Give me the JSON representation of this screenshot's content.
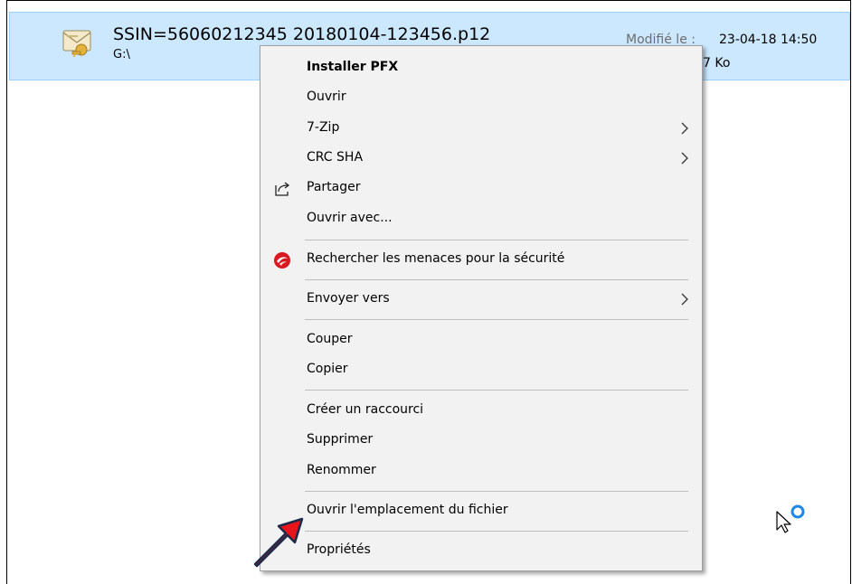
{
  "file": {
    "name": "SSIN=56060212345 20180104-123456.p12",
    "path": "G:\\",
    "modified_label": "Modifié le :",
    "modified_value": "23-04-18 14:50",
    "size_value": "7 Ko",
    "icon": "certificate-file-icon"
  },
  "context_menu": {
    "items": [
      {
        "label": "Installer PFX",
        "bold": true
      },
      {
        "label": "Ouvrir"
      },
      {
        "label": "7-Zip",
        "submenu": true
      },
      {
        "label": "CRC SHA",
        "submenu": true
      },
      {
        "label": "Partager",
        "icon": "share-icon"
      },
      {
        "label": "Ouvrir avec..."
      },
      {
        "label": "Rechercher les menaces pour la sécurité",
        "icon": "trend-micro-icon"
      },
      {
        "label": "Envoyer vers",
        "submenu": true
      },
      {
        "label": "Couper"
      },
      {
        "label": "Copier"
      },
      {
        "label": "Créer un raccourci"
      },
      {
        "label": "Supprimer"
      },
      {
        "label": "Renommer"
      },
      {
        "label": "Ouvrir l'emplacement du fichier"
      },
      {
        "label": "Propriétés"
      }
    ]
  },
  "colors": {
    "selection_bg": "#cce8ff",
    "menu_bg": "#f2f2f2",
    "annotation_arrow": "#e8141c"
  }
}
